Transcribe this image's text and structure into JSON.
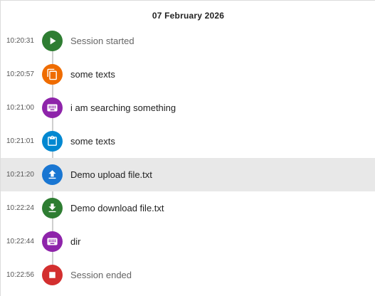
{
  "date_header": "07 February 2026",
  "colors": {
    "green": "#2e7d32",
    "orange": "#ef6c00",
    "purple": "#8e24aa",
    "blue": "#0288d1",
    "upload_blue": "#1976d2",
    "red": "#d32f2f",
    "selected_bg": "#e8e8e8"
  },
  "events": [
    {
      "time": "10:20:31",
      "label": "Session started",
      "icon": "play-icon",
      "color": "green",
      "muted": true
    },
    {
      "time": "10:20:57",
      "label": "some texts",
      "icon": "copy-icon",
      "color": "orange",
      "muted": false
    },
    {
      "time": "10:21:00",
      "label": "i am searching something",
      "icon": "keyboard-icon",
      "color": "purple",
      "muted": false
    },
    {
      "time": "10:21:01",
      "label": "some texts",
      "icon": "clipboard-icon",
      "color": "blue",
      "muted": false
    },
    {
      "time": "10:21:20",
      "label": "Demo upload file.txt",
      "icon": "upload-icon",
      "color": "upload_blue",
      "muted": false,
      "selected": true
    },
    {
      "time": "10:22:24",
      "label": "Demo download file.txt",
      "icon": "download-icon",
      "color": "green",
      "muted": false
    },
    {
      "time": "10:22:44",
      "label": "dir",
      "icon": "keyboard-icon",
      "color": "purple",
      "muted": false
    },
    {
      "time": "10:22:56",
      "label": "Session ended",
      "icon": "stop-icon",
      "color": "red",
      "muted": true
    }
  ]
}
